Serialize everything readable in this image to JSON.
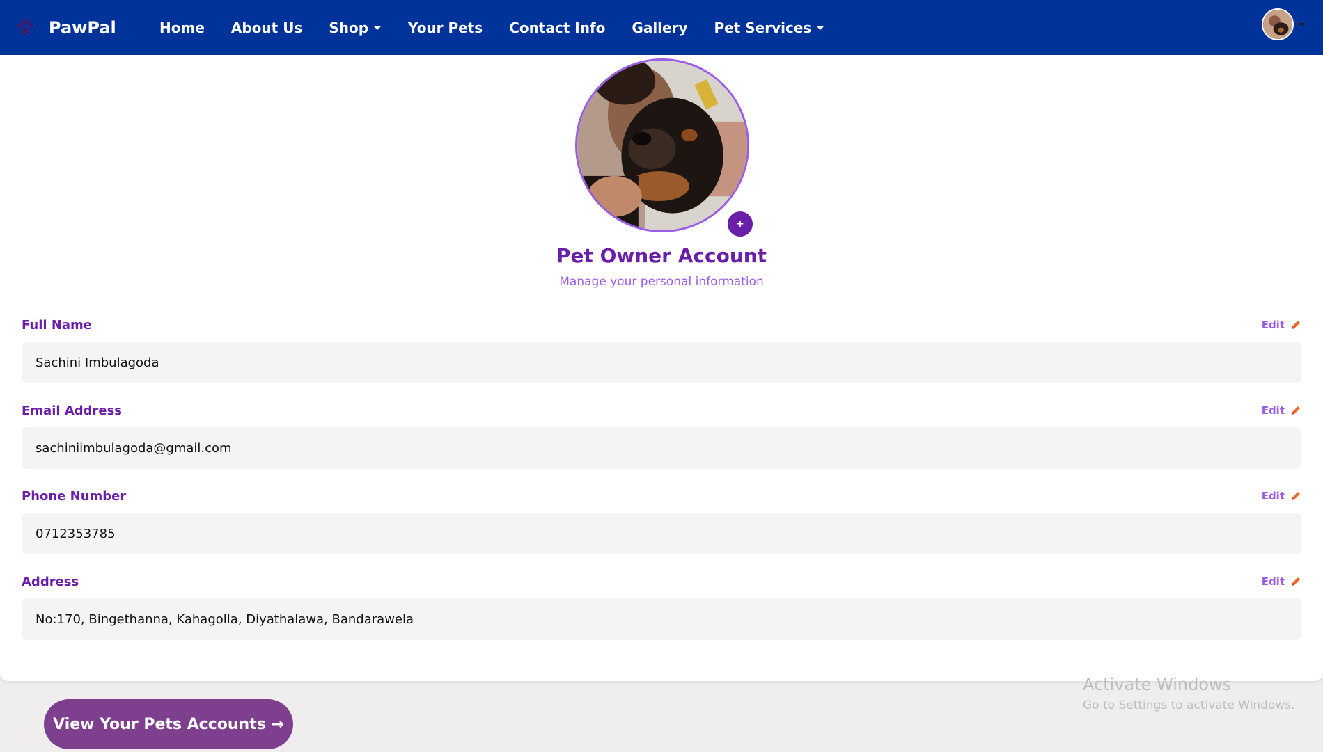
{
  "navbar": {
    "brand": "PawPal",
    "brand_icon": "paw-icon",
    "links": [
      {
        "label": "Home",
        "has_caret": false
      },
      {
        "label": "About Us",
        "has_caret": false
      },
      {
        "label": "Shop",
        "has_caret": true
      },
      {
        "label": "Your Pets",
        "has_caret": false
      },
      {
        "label": "Contact Info",
        "has_caret": false
      },
      {
        "label": "Gallery",
        "has_caret": false
      },
      {
        "label": "Pet Services",
        "has_caret": true
      }
    ],
    "background_color": "#003399"
  },
  "profile": {
    "add_photo_icon": "plus-icon",
    "add_photo_symbol": "+",
    "title": "Pet Owner Account",
    "subtitle": "Manage your personal information"
  },
  "fields": [
    {
      "label": "Full Name",
      "edit_label": "Edit",
      "value": "Sachini Imbulagoda"
    },
    {
      "label": "Email Address",
      "edit_label": "Edit",
      "value": "sachiniimbulagoda@gmail.com"
    },
    {
      "label": "Phone Number",
      "edit_label": "Edit",
      "value": "0712353785"
    },
    {
      "label": "Address",
      "edit_label": "Edit",
      "value": "No:170, Bingethanna, Kahagolla, Diyathalawa, Bandarawela"
    }
  ],
  "actions": {
    "view_pets_label": "View Your Pets Accounts →"
  },
  "watermark": {
    "title": "Activate Windows",
    "subtitle": "Go to Settings to activate Windows."
  },
  "colors": {
    "accent": "#6a1fa8",
    "accent_light": "#9b5de5",
    "edit_icon": "#e8692e",
    "button": "#7e3f8f"
  }
}
